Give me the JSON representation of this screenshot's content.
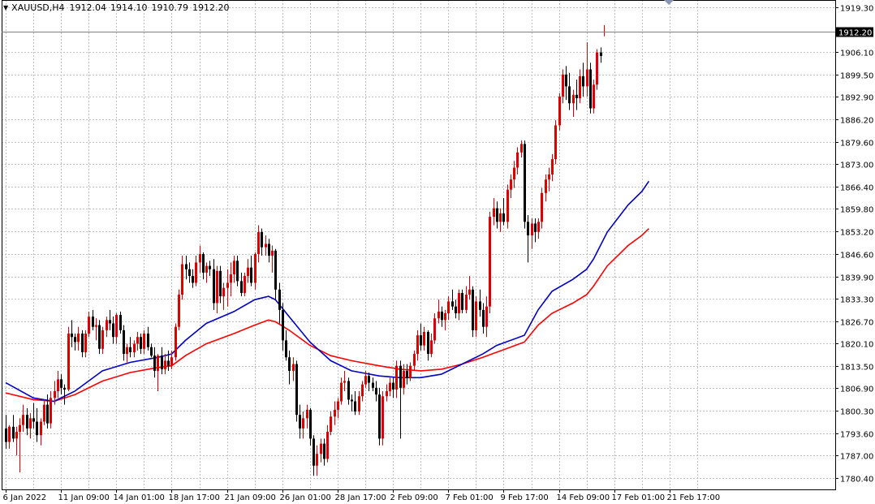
{
  "header": {
    "symbol": "XAUUSD,H4",
    "open": "1912.04",
    "high": "1914.10",
    "low": "1910.79",
    "close": "1912.20"
  },
  "chart_data": {
    "type": "candlestick",
    "grid": true,
    "colors": {
      "background": "#ffffff",
      "bull": "#e00000",
      "bear": "#000000",
      "ma_fast": "#0000c8",
      "ma_slow": "#ff0000",
      "price_tag_bg": "#000000"
    },
    "ylim": [
      1777.0,
      1921.5
    ],
    "y_ticks": [
      "1919.30",
      "1906.10",
      "1899.50",
      "1892.90",
      "1886.20",
      "1879.60",
      "1873.00",
      "1866.40",
      "1859.80",
      "1853.20",
      "1846.60",
      "1839.90",
      "1833.30",
      "1826.70",
      "1820.10",
      "1813.50",
      "1806.90",
      "1800.30",
      "1793.60",
      "1787.00",
      "1780.40"
    ],
    "current_price": "1912.20",
    "x_ticks": [
      {
        "label": "6 Jan 2022",
        "bar": 0
      },
      {
        "label": "11 Jan 09:00",
        "bar": 16
      },
      {
        "label": "14 Jan 01:00",
        "bar": 32
      },
      {
        "label": "18 Jan 17:00",
        "bar": 48
      },
      {
        "label": "21 Jan 09:00",
        "bar": 64
      },
      {
        "label": "26 Jan 01:00",
        "bar": 80
      },
      {
        "label": "28 Jan 17:00",
        "bar": 96
      },
      {
        "label": "2 Feb 09:00",
        "bar": 112
      },
      {
        "label": "7 Feb 01:00",
        "bar": 128
      },
      {
        "label": "9 Feb 17:00",
        "bar": 144
      },
      {
        "label": "14 Feb 09:00",
        "bar": 160
      },
      {
        "label": "17 Feb 01:00",
        "bar": 176
      },
      {
        "label": "21 Feb 17:00",
        "bar": 192
      }
    ],
    "ohlc": [
      [
        1795.0,
        1799.0,
        1789.0,
        1791.0
      ],
      [
        1791.0,
        1796.0,
        1789.0,
        1795.5
      ],
      [
        1795.5,
        1799.0,
        1791.0,
        1792.0
      ],
      [
        1792.0,
        1795.5,
        1787.0,
        1794.0
      ],
      [
        1794.0,
        1798.0,
        1782.0,
        1796.0
      ],
      [
        1796.0,
        1802.0,
        1794.0,
        1799.0
      ],
      [
        1799.0,
        1801.0,
        1793.0,
        1795.0
      ],
      [
        1795.0,
        1799.5,
        1792.0,
        1798.0
      ],
      [
        1798.0,
        1802.5,
        1795.0,
        1797.0
      ],
      [
        1797.0,
        1801.0,
        1791.0,
        1793.0
      ],
      [
        1793.0,
        1798.0,
        1790.0,
        1797.0
      ],
      [
        1797.0,
        1803.5,
        1796.0,
        1802.0
      ],
      [
        1802.0,
        1805.0,
        1795.0,
        1796.5
      ],
      [
        1796.5,
        1806.0,
        1795.0,
        1804.0
      ],
      [
        1804.0,
        1809.0,
        1802.0,
        1806.0
      ],
      [
        1806.0,
        1812.0,
        1804.0,
        1809.5
      ],
      [
        1809.5,
        1811.0,
        1805.0,
        1807.0
      ],
      [
        1807.0,
        1808.0,
        1802.0,
        1806.5
      ],
      [
        1806.5,
        1825.0,
        1806.0,
        1823.0
      ],
      [
        1823.0,
        1827.0,
        1819.0,
        1822.0
      ],
      [
        1822.0,
        1823.0,
        1818.0,
        1820.5
      ],
      [
        1820.5,
        1825.0,
        1818.0,
        1823.0
      ],
      [
        1823.0,
        1824.0,
        1816.0,
        1817.5
      ],
      [
        1817.5,
        1824.0,
        1816.0,
        1823.0
      ],
      [
        1823.0,
        1829.5,
        1822.0,
        1828.0
      ],
      [
        1828.0,
        1830.0,
        1824.0,
        1825.0
      ],
      [
        1825.0,
        1827.5,
        1821.0,
        1825.5
      ],
      [
        1825.5,
        1827.0,
        1817.0,
        1818.5
      ],
      [
        1818.5,
        1825.0,
        1817.0,
        1824.0
      ],
      [
        1824.0,
        1828.0,
        1822.0,
        1827.0
      ],
      [
        1827.0,
        1830.0,
        1824.0,
        1826.0
      ],
      [
        1826.0,
        1828.0,
        1820.0,
        1822.0
      ],
      [
        1822.0,
        1829.0,
        1820.0,
        1828.5
      ],
      [
        1828.5,
        1829.5,
        1823.0,
        1824.0
      ],
      [
        1824.0,
        1825.5,
        1815.0,
        1817.0
      ],
      [
        1817.0,
        1820.0,
        1814.5,
        1819.0
      ],
      [
        1819.0,
        1822.0,
        1816.0,
        1817.5
      ],
      [
        1817.5,
        1821.0,
        1816.0,
        1820.0
      ],
      [
        1820.0,
        1823.5,
        1818.0,
        1822.0
      ],
      [
        1822.0,
        1823.0,
        1817.0,
        1818.5
      ],
      [
        1818.5,
        1824.0,
        1817.0,
        1823.0
      ],
      [
        1823.0,
        1825.0,
        1818.0,
        1819.0
      ],
      [
        1819.0,
        1820.0,
        1816.0,
        1816.5
      ],
      [
        1816.5,
        1819.0,
        1810.0,
        1812.0
      ],
      [
        1812.0,
        1817.0,
        1806.0,
        1816.5
      ],
      [
        1816.5,
        1819.0,
        1811.0,
        1812.5
      ],
      [
        1812.5,
        1817.0,
        1811.0,
        1815.0
      ],
      [
        1815.0,
        1818.0,
        1812.0,
        1813.5
      ],
      [
        1813.5,
        1818.0,
        1812.5,
        1816.0
      ],
      [
        1816.0,
        1826.0,
        1815.0,
        1825.0
      ],
      [
        1825.0,
        1836.0,
        1824.0,
        1834.5
      ],
      [
        1834.5,
        1846.0,
        1833.0,
        1843.5
      ],
      [
        1843.5,
        1846.0,
        1839.0,
        1842.0
      ],
      [
        1842.0,
        1844.0,
        1838.0,
        1840.0
      ],
      [
        1840.0,
        1842.0,
        1836.5,
        1838.0
      ],
      [
        1838.0,
        1846.0,
        1837.0,
        1844.0
      ],
      [
        1844.0,
        1849.0,
        1841.0,
        1846.5
      ],
      [
        1846.5,
        1847.0,
        1839.0,
        1841.0
      ],
      [
        1841.0,
        1844.0,
        1838.0,
        1843.0
      ],
      [
        1843.0,
        1844.5,
        1840.0,
        1842.0
      ],
      [
        1842.0,
        1845.0,
        1830.0,
        1832.0
      ],
      [
        1832.0,
        1843.0,
        1829.0,
        1841.5
      ],
      [
        1841.5,
        1843.0,
        1832.0,
        1834.0
      ],
      [
        1834.0,
        1838.0,
        1830.0,
        1836.5
      ],
      [
        1836.5,
        1842.0,
        1831.0,
        1838.0
      ],
      [
        1838.0,
        1844.0,
        1834.0,
        1840.5
      ],
      [
        1840.5,
        1846.0,
        1838.0,
        1844.5
      ],
      [
        1844.5,
        1846.0,
        1837.0,
        1838.5
      ],
      [
        1838.5,
        1841.0,
        1834.0,
        1835.0
      ],
      [
        1835.0,
        1841.0,
        1834.0,
        1840.0
      ],
      [
        1840.0,
        1845.0,
        1838.0,
        1842.5
      ],
      [
        1842.5,
        1846.0,
        1837.0,
        1838.0
      ],
      [
        1838.0,
        1847.0,
        1836.0,
        1846.5
      ],
      [
        1846.5,
        1855.0,
        1844.0,
        1853.0
      ],
      [
        1853.0,
        1854.0,
        1846.0,
        1848.5
      ],
      [
        1848.5,
        1852.0,
        1846.0,
        1849.5
      ],
      [
        1849.5,
        1851.0,
        1844.0,
        1846.0
      ],
      [
        1846.0,
        1849.0,
        1841.0,
        1847.5
      ],
      [
        1847.5,
        1848.0,
        1833.0,
        1836.0
      ],
      [
        1836.0,
        1838.0,
        1826.0,
        1830.0
      ],
      [
        1830.0,
        1832.0,
        1818.0,
        1821.0
      ],
      [
        1821.0,
        1824.0,
        1815.0,
        1816.0
      ],
      [
        1816.0,
        1818.0,
        1808.0,
        1812.0
      ],
      [
        1812.0,
        1816.0,
        1809.0,
        1814.0
      ],
      [
        1814.0,
        1815.0,
        1797.0,
        1799.0
      ],
      [
        1799.0,
        1802.0,
        1792.0,
        1795.0
      ],
      [
        1795.0,
        1800.0,
        1792.0,
        1798.0
      ],
      [
        1798.0,
        1802.0,
        1795.0,
        1800.5
      ],
      [
        1800.5,
        1801.0,
        1790.0,
        1792.0
      ],
      [
        1792.0,
        1793.0,
        1781.0,
        1784.0
      ],
      [
        1784.0,
        1790.0,
        1781.0,
        1787.5
      ],
      [
        1787.5,
        1792.0,
        1785.0,
        1790.5
      ],
      [
        1790.5,
        1792.0,
        1784.0,
        1786.0
      ],
      [
        1786.0,
        1796.0,
        1785.0,
        1794.0
      ],
      [
        1794.0,
        1800.0,
        1793.0,
        1798.5
      ],
      [
        1798.5,
        1803.0,
        1796.0,
        1800.5
      ],
      [
        1800.5,
        1804.0,
        1798.0,
        1803.0
      ],
      [
        1803.0,
        1810.0,
        1802.0,
        1808.5
      ],
      [
        1808.5,
        1812.0,
        1806.0,
        1809.0
      ],
      [
        1809.0,
        1810.0,
        1802.0,
        1803.5
      ],
      [
        1803.5,
        1805.0,
        1800.0,
        1803.0
      ],
      [
        1803.0,
        1806.0,
        1799.0,
        1800.0
      ],
      [
        1800.0,
        1806.0,
        1799.0,
        1804.5
      ],
      [
        1804.5,
        1809.0,
        1803.0,
        1808.0
      ],
      [
        1808.0,
        1812.0,
        1807.0,
        1810.5
      ],
      [
        1810.5,
        1811.5,
        1806.0,
        1808.5
      ],
      [
        1808.5,
        1810.0,
        1806.0,
        1807.0
      ],
      [
        1807.0,
        1809.0,
        1803.0,
        1805.0
      ],
      [
        1805.0,
        1807.0,
        1790.0,
        1792.0
      ],
      [
        1792.0,
        1806.0,
        1790.0,
        1804.5
      ],
      [
        1804.5,
        1808.0,
        1803.0,
        1806.0
      ],
      [
        1806.0,
        1810.0,
        1804.5,
        1808.5
      ],
      [
        1808.5,
        1810.0,
        1804.0,
        1806.5
      ],
      [
        1806.5,
        1815.0,
        1804.0,
        1813.5
      ],
      [
        1813.5,
        1815.0,
        1792.0,
        1807.0
      ],
      [
        1807.0,
        1814.0,
        1805.0,
        1812.0
      ],
      [
        1812.0,
        1814.0,
        1808.0,
        1810.0
      ],
      [
        1810.0,
        1814.5,
        1809.0,
        1813.5
      ],
      [
        1813.5,
        1818.0,
        1812.0,
        1817.0
      ],
      [
        1817.0,
        1824.0,
        1815.0,
        1822.5
      ],
      [
        1822.5,
        1826.0,
        1818.0,
        1819.5
      ],
      [
        1819.5,
        1825.0,
        1818.0,
        1823.5
      ],
      [
        1823.5,
        1824.0,
        1815.0,
        1817.0
      ],
      [
        1817.0,
        1823.0,
        1816.0,
        1821.0
      ],
      [
        1821.0,
        1829.0,
        1820.0,
        1827.5
      ],
      [
        1827.5,
        1833.0,
        1826.0,
        1829.5
      ],
      [
        1829.5,
        1831.0,
        1825.0,
        1827.0
      ],
      [
        1827.0,
        1830.0,
        1824.0,
        1829.0
      ],
      [
        1829.0,
        1834.0,
        1827.0,
        1832.5
      ],
      [
        1832.5,
        1836.0,
        1830.0,
        1831.0
      ],
      [
        1831.0,
        1833.0,
        1827.5,
        1829.0
      ],
      [
        1829.0,
        1836.0,
        1827.0,
        1835.0
      ],
      [
        1835.0,
        1836.0,
        1829.0,
        1830.0
      ],
      [
        1830.0,
        1837.0,
        1829.0,
        1834.5
      ],
      [
        1834.5,
        1840.0,
        1833.0,
        1836.0
      ],
      [
        1836.0,
        1837.0,
        1822.0,
        1824.0
      ],
      [
        1824.0,
        1834.0,
        1822.0,
        1832.5
      ],
      [
        1832.5,
        1836.0,
        1828.0,
        1830.0
      ],
      [
        1830.0,
        1832.0,
        1823.0,
        1825.0
      ],
      [
        1825.0,
        1834.0,
        1822.0,
        1831.0
      ],
      [
        1831.0,
        1859.0,
        1829.0,
        1857.5
      ],
      [
        1857.5,
        1863.0,
        1855.0,
        1860.0
      ],
      [
        1860.0,
        1862.0,
        1854.0,
        1856.0
      ],
      [
        1856.0,
        1860.0,
        1853.0,
        1858.5
      ],
      [
        1858.5,
        1863.0,
        1855.0,
        1856.0
      ],
      [
        1856.0,
        1867.0,
        1854.0,
        1865.5
      ],
      [
        1865.5,
        1870.0,
        1863.0,
        1868.5
      ],
      [
        1868.5,
        1874.0,
        1866.0,
        1872.0
      ],
      [
        1872.0,
        1878.0,
        1870.0,
        1876.5
      ],
      [
        1876.5,
        1880.0,
        1875.0,
        1879.0
      ],
      [
        1879.0,
        1880.0,
        1854.0,
        1856.0
      ],
      [
        1856.0,
        1858.0,
        1844.0,
        1852.0
      ],
      [
        1852.0,
        1857.0,
        1848.0,
        1855.5
      ],
      [
        1855.5,
        1857.0,
        1850.0,
        1853.0
      ],
      [
        1853.0,
        1857.0,
        1851.0,
        1856.0
      ],
      [
        1856.0,
        1866.0,
        1854.0,
        1864.5
      ],
      [
        1864.5,
        1870.0,
        1862.0,
        1868.5
      ],
      [
        1868.5,
        1872.0,
        1865.0,
        1870.0
      ],
      [
        1870.0,
        1876.0,
        1868.0,
        1874.5
      ],
      [
        1874.5,
        1886.0,
        1873.0,
        1884.5
      ],
      [
        1884.5,
        1894.0,
        1883.0,
        1893.0
      ],
      [
        1893.0,
        1901.0,
        1891.0,
        1899.5
      ],
      [
        1899.5,
        1902.0,
        1892.0,
        1896.0
      ],
      [
        1896.0,
        1900.0,
        1889.0,
        1891.0
      ],
      [
        1891.0,
        1895.0,
        1887.0,
        1893.5
      ],
      [
        1893.5,
        1898.0,
        1889.0,
        1892.5
      ],
      [
        1892.5,
        1901.0,
        1891.0,
        1899.0
      ],
      [
        1899.0,
        1903.0,
        1893.0,
        1896.0
      ],
      [
        1896.0,
        1909.0,
        1893.0,
        1901.0
      ],
      [
        1901.0,
        1903.0,
        1888.0,
        1889.5
      ],
      [
        1889.5,
        1898.0,
        1888.0,
        1896.5
      ],
      [
        1896.5,
        1907.0,
        1895.0,
        1906.0
      ],
      [
        1906.0,
        1907.5,
        1903.0,
        1905.0
      ],
      [
        1912.04,
        1914.1,
        1910.79,
        1912.2
      ]
    ],
    "ma_fast": [
      [
        0,
        1808.5
      ],
      [
        8,
        1804.0
      ],
      [
        14,
        1803.0
      ],
      [
        20,
        1806.0
      ],
      [
        28,
        1812.0
      ],
      [
        36,
        1814.5
      ],
      [
        44,
        1816.0
      ],
      [
        48,
        1817.0
      ],
      [
        52,
        1821.0
      ],
      [
        58,
        1826.0
      ],
      [
        66,
        1829.5
      ],
      [
        72,
        1833.0
      ],
      [
        76,
        1834.0
      ],
      [
        78,
        1833.0
      ],
      [
        82,
        1828.0
      ],
      [
        88,
        1820.5
      ],
      [
        94,
        1815.0
      ],
      [
        100,
        1812.0
      ],
      [
        108,
        1810.5
      ],
      [
        114,
        1810.0
      ],
      [
        120,
        1810.0
      ],
      [
        126,
        1811.0
      ],
      [
        132,
        1814.0
      ],
      [
        138,
        1817.0
      ],
      [
        142,
        1819.5
      ],
      [
        146,
        1821.0
      ],
      [
        150,
        1822.5
      ],
      [
        154,
        1830.0
      ],
      [
        158,
        1835.5
      ],
      [
        164,
        1839.0
      ],
      [
        168,
        1842.0
      ],
      [
        170,
        1845.0
      ],
      [
        174,
        1853.0
      ],
      [
        180,
        1861.0
      ],
      [
        184,
        1865.0
      ],
      [
        186,
        1868.0
      ]
    ],
    "ma_slow": [
      [
        0,
        1805.5
      ],
      [
        8,
        1803.5
      ],
      [
        14,
        1803.0
      ],
      [
        20,
        1805.0
      ],
      [
        28,
        1809.0
      ],
      [
        36,
        1811.5
      ],
      [
        44,
        1813.0
      ],
      [
        48,
        1813.5
      ],
      [
        52,
        1816.5
      ],
      [
        58,
        1820.0
      ],
      [
        66,
        1823.0
      ],
      [
        72,
        1825.5
      ],
      [
        76,
        1827.0
      ],
      [
        78,
        1826.5
      ],
      [
        82,
        1824.0
      ],
      [
        88,
        1819.5
      ],
      [
        94,
        1816.5
      ],
      [
        100,
        1815.0
      ],
      [
        108,
        1813.5
      ],
      [
        114,
        1812.5
      ],
      [
        120,
        1812.0
      ],
      [
        126,
        1812.5
      ],
      [
        132,
        1814.0
      ],
      [
        138,
        1816.0
      ],
      [
        142,
        1817.5
      ],
      [
        146,
        1819.0
      ],
      [
        150,
        1820.5
      ],
      [
        154,
        1825.5
      ],
      [
        158,
        1829.0
      ],
      [
        164,
        1832.0
      ],
      [
        168,
        1834.5
      ],
      [
        170,
        1837.0
      ],
      [
        174,
        1843.0
      ],
      [
        180,
        1849.0
      ],
      [
        184,
        1852.0
      ],
      [
        186,
        1854.0
      ]
    ]
  }
}
